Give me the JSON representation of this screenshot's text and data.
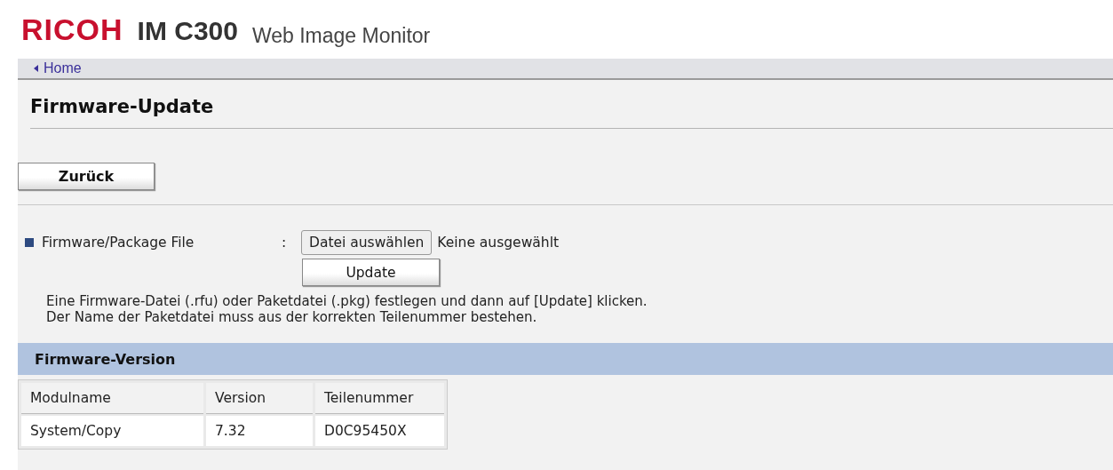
{
  "header": {
    "brand": "RICOH",
    "model": "IM C300",
    "product": "Web Image Monitor"
  },
  "nav": {
    "link": "Home"
  },
  "page_title": "Firmware-Update",
  "back_button": "Zurück",
  "file_field": {
    "label": "Firmware/Package File",
    "separator": ":",
    "choose_button": "Datei auswählen",
    "status": "Keine ausgewählt"
  },
  "update_button": "Update",
  "notes": [
    "Eine Firmware-Datei (.rfu) oder Paketdatei (.pkg) festlegen und dann auf [Update] klicken.",
    "Der Name der Paketdatei muss aus der korrekten Teilenummer bestehen."
  ],
  "section": {
    "title": "Firmware-Version"
  },
  "table": {
    "columns": [
      "Modulname",
      "Version",
      "Teilenummer"
    ],
    "rows": [
      [
        "System/Copy",
        "7.32",
        "D0C95450X"
      ]
    ]
  }
}
